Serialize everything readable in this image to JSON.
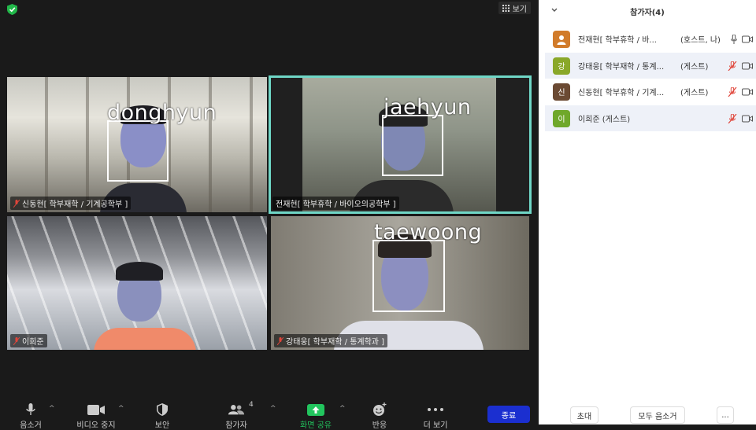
{
  "top": {
    "view_label": "보기",
    "security_icon": "green-shield-icon",
    "view_icon": "grid-icon"
  },
  "tiles": [
    {
      "name": "신동현[ 학부재학 / 기계공학부 ]",
      "face_label": "donghyun"
    },
    {
      "name": "전재현[ 학부휴학 / 바이오의공학부 ]",
      "face_label": "jaehyun",
      "active": true
    },
    {
      "name": "이희준"
    },
    {
      "name": "강태웅[ 학부재학 / 통계학과 ]",
      "face_label": "taewoong"
    }
  ],
  "toolbar": {
    "mute": "음소거",
    "video": "비디오 중지",
    "security": "보안",
    "participants": "참가자",
    "participants_count": "4",
    "share": "화면 공유",
    "reactions": "반응",
    "more": "더 보기",
    "end": "종료"
  },
  "panel": {
    "title": "참가자(4)",
    "participants": [
      {
        "avatar_letter": "",
        "avatar_color": "#d17b2a",
        "name": "전재현[ 학부휴학 / 바...",
        "role": "(호스트, 나)",
        "muted": false
      },
      {
        "avatar_letter": "강",
        "avatar_color": "#8aa829",
        "name": "강태웅[ 학부재학 / 통계...",
        "role": "(게스트)",
        "muted": true
      },
      {
        "avatar_letter": "신",
        "avatar_color": "#6b4a33",
        "name": "신동현[ 학부휴학 / 기계...",
        "role": "(게스트)",
        "muted": true
      },
      {
        "avatar_letter": "이",
        "avatar_color": "#6fa82a",
        "name": "이희준 (게스트)",
        "role": "",
        "muted": true
      }
    ],
    "invite": "초대",
    "mute_all": "모두 음소거",
    "more": "..."
  },
  "colors": {
    "end_button": "#1b2fd0",
    "active_border": "#6fd6c6",
    "share_green": "#22c55e",
    "muted_red": "#e0453a"
  }
}
